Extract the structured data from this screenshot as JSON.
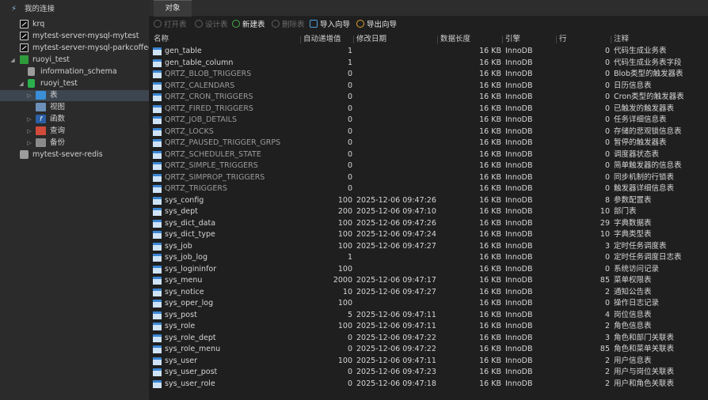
{
  "sidebar": {
    "items": [
      {
        "label": "我的连接",
        "icon": "connections-icon"
      },
      {
        "label": "krq",
        "icon": "connection-icon"
      },
      {
        "label": "mytest-server-mysql-mytest",
        "icon": "connection-icon"
      },
      {
        "label": "mytest-server-mysql-parkcoffee",
        "icon": "connection-icon"
      },
      {
        "label": "ruoyi_test",
        "icon": "connection-icon"
      },
      {
        "label": "information_schema",
        "icon": "database-icon"
      },
      {
        "label": "ruoyi_test",
        "icon": "database-icon"
      },
      {
        "label": "表",
        "icon": "table-icon"
      },
      {
        "label": "视图",
        "icon": "view-icon"
      },
      {
        "label": "函数",
        "icon": "function-icon"
      },
      {
        "label": "查询",
        "icon": "query-icon"
      },
      {
        "label": "备份",
        "icon": "backup-icon"
      },
      {
        "label": "mytest-sever-redis",
        "icon": "redis-icon"
      }
    ]
  },
  "tabs": {
    "objects": "对象"
  },
  "toolbar": {
    "open": "打开表",
    "design": "设计表",
    "new": "新建表",
    "delete": "删除表",
    "import": "导入向导",
    "export": "导出向导"
  },
  "columns": {
    "name": "名称",
    "auto_inc": "自动递增值",
    "modified": "修改日期",
    "data_length": "数据长度",
    "engine": "引擎",
    "rows": "行",
    "comment": "注释"
  },
  "tables": [
    {
      "name": "gen_table",
      "auto_inc": "1",
      "modified": "",
      "size": "16 KB",
      "engine": "InnoDB",
      "rows": "0",
      "comment": "代码生成业务表"
    },
    {
      "name": "gen_table_column",
      "auto_inc": "1",
      "modified": "",
      "size": "16 KB",
      "engine": "InnoDB",
      "rows": "0",
      "comment": "代码生成业务表字段"
    },
    {
      "name": "QRTZ_BLOB_TRIGGERS",
      "auto_inc": "0",
      "modified": "",
      "size": "16 KB",
      "engine": "InnoDB",
      "rows": "0",
      "comment": "Blob类型的触发器表"
    },
    {
      "name": "QRTZ_CALENDARS",
      "auto_inc": "0",
      "modified": "",
      "size": "16 KB",
      "engine": "InnoDB",
      "rows": "0",
      "comment": "日历信息表"
    },
    {
      "name": "QRTZ_CRON_TRIGGERS",
      "auto_inc": "0",
      "modified": "",
      "size": "16 KB",
      "engine": "InnoDB",
      "rows": "0",
      "comment": "Cron类型的触发器表"
    },
    {
      "name": "QRTZ_FIRED_TRIGGERS",
      "auto_inc": "0",
      "modified": "",
      "size": "16 KB",
      "engine": "InnoDB",
      "rows": "0",
      "comment": "已触发的触发器表"
    },
    {
      "name": "QRTZ_JOB_DETAILS",
      "auto_inc": "0",
      "modified": "",
      "size": "16 KB",
      "engine": "InnoDB",
      "rows": "0",
      "comment": "任务详细信息表"
    },
    {
      "name": "QRTZ_LOCKS",
      "auto_inc": "0",
      "modified": "",
      "size": "16 KB",
      "engine": "InnoDB",
      "rows": "0",
      "comment": "存储的悲观锁信息表"
    },
    {
      "name": "QRTZ_PAUSED_TRIGGER_GRPS",
      "auto_inc": "0",
      "modified": "",
      "size": "16 KB",
      "engine": "InnoDB",
      "rows": "0",
      "comment": "暂停的触发器表"
    },
    {
      "name": "QRTZ_SCHEDULER_STATE",
      "auto_inc": "0",
      "modified": "",
      "size": "16 KB",
      "engine": "InnoDB",
      "rows": "0",
      "comment": "调度器状态表"
    },
    {
      "name": "QRTZ_SIMPLE_TRIGGERS",
      "auto_inc": "0",
      "modified": "",
      "size": "16 KB",
      "engine": "InnoDB",
      "rows": "0",
      "comment": "简单触发器的信息表"
    },
    {
      "name": "QRTZ_SIMPROP_TRIGGERS",
      "auto_inc": "0",
      "modified": "",
      "size": "16 KB",
      "engine": "InnoDB",
      "rows": "0",
      "comment": "同步机制的行锁表"
    },
    {
      "name": "QRTZ_TRIGGERS",
      "auto_inc": "0",
      "modified": "",
      "size": "16 KB",
      "engine": "InnoDB",
      "rows": "0",
      "comment": "触发器详细信息表"
    },
    {
      "name": "sys_config",
      "auto_inc": "100",
      "modified": "2025-12-06 09:47:26",
      "size": "16 KB",
      "engine": "InnoDB",
      "rows": "8",
      "comment": "参数配置表"
    },
    {
      "name": "sys_dept",
      "auto_inc": "200",
      "modified": "2025-12-06 09:47:10",
      "size": "16 KB",
      "engine": "InnoDB",
      "rows": "10",
      "comment": "部门表"
    },
    {
      "name": "sys_dict_data",
      "auto_inc": "100",
      "modified": "2025-12-06 09:47:26",
      "size": "16 KB",
      "engine": "InnoDB",
      "rows": "29",
      "comment": "字典数据表"
    },
    {
      "name": "sys_dict_type",
      "auto_inc": "100",
      "modified": "2025-12-06 09:47:24",
      "size": "16 KB",
      "engine": "InnoDB",
      "rows": "10",
      "comment": "字典类型表"
    },
    {
      "name": "sys_job",
      "auto_inc": "100",
      "modified": "2025-12-06 09:47:27",
      "size": "16 KB",
      "engine": "InnoDB",
      "rows": "3",
      "comment": "定时任务调度表"
    },
    {
      "name": "sys_job_log",
      "auto_inc": "1",
      "modified": "",
      "size": "16 KB",
      "engine": "InnoDB",
      "rows": "0",
      "comment": "定时任务调度日志表"
    },
    {
      "name": "sys_logininfor",
      "auto_inc": "100",
      "modified": "",
      "size": "16 KB",
      "engine": "InnoDB",
      "rows": "0",
      "comment": "系统访问记录"
    },
    {
      "name": "sys_menu",
      "auto_inc": "2000",
      "modified": "2025-12-06 09:47:17",
      "size": "16 KB",
      "engine": "InnoDB",
      "rows": "85",
      "comment": "菜单权限表"
    },
    {
      "name": "sys_notice",
      "auto_inc": "10",
      "modified": "2025-12-06 09:47:27",
      "size": "16 KB",
      "engine": "InnoDB",
      "rows": "2",
      "comment": "通知公告表"
    },
    {
      "name": "sys_oper_log",
      "auto_inc": "100",
      "modified": "",
      "size": "16 KB",
      "engine": "InnoDB",
      "rows": "0",
      "comment": "操作日志记录"
    },
    {
      "name": "sys_post",
      "auto_inc": "5",
      "modified": "2025-12-06 09:47:11",
      "size": "16 KB",
      "engine": "InnoDB",
      "rows": "4",
      "comment": "岗位信息表"
    },
    {
      "name": "sys_role",
      "auto_inc": "100",
      "modified": "2025-12-06 09:47:11",
      "size": "16 KB",
      "engine": "InnoDB",
      "rows": "2",
      "comment": "角色信息表"
    },
    {
      "name": "sys_role_dept",
      "auto_inc": "0",
      "modified": "2025-12-06 09:47:22",
      "size": "16 KB",
      "engine": "InnoDB",
      "rows": "3",
      "comment": "角色和部门关联表"
    },
    {
      "name": "sys_role_menu",
      "auto_inc": "0",
      "modified": "2025-12-06 09:47:22",
      "size": "16 KB",
      "engine": "InnoDB",
      "rows": "85",
      "comment": "角色和菜单关联表"
    },
    {
      "name": "sys_user",
      "auto_inc": "100",
      "modified": "2025-12-06 09:47:11",
      "size": "16 KB",
      "engine": "InnoDB",
      "rows": "2",
      "comment": "用户信息表"
    },
    {
      "name": "sys_user_post",
      "auto_inc": "0",
      "modified": "2025-12-06 09:47:23",
      "size": "16 KB",
      "engine": "InnoDB",
      "rows": "2",
      "comment": "用户与岗位关联表"
    },
    {
      "name": "sys_user_role",
      "auto_inc": "0",
      "modified": "2025-12-06 09:47:18",
      "size": "16 KB",
      "engine": "InnoDB",
      "rows": "2",
      "comment": "用户和角色关联表"
    }
  ]
}
